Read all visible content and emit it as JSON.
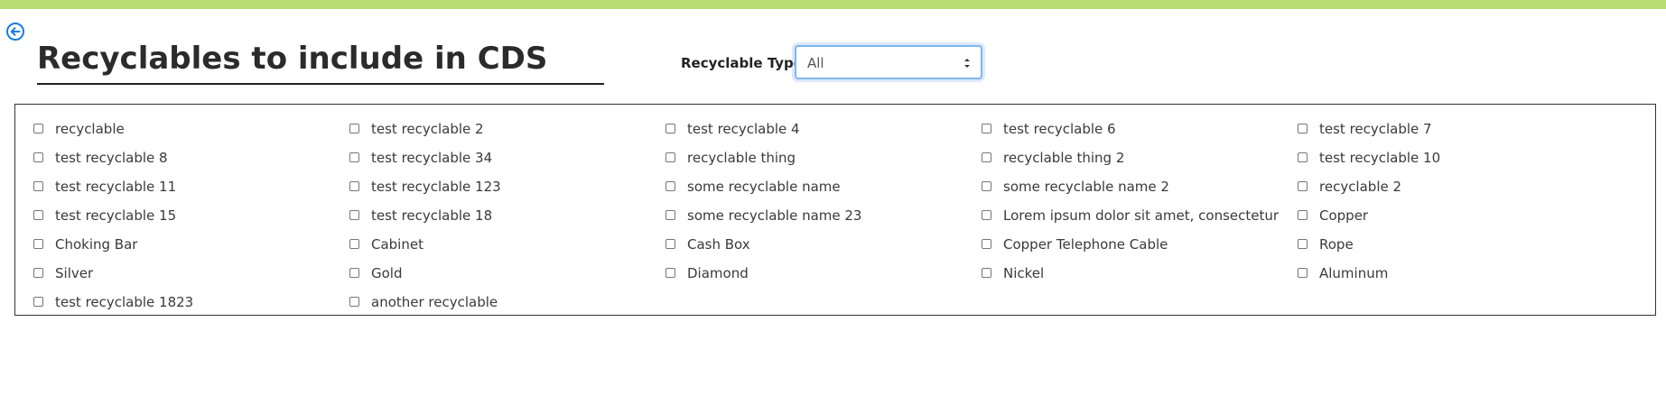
{
  "colors": {
    "top_bar": "#b9dc73",
    "back_icon": "#1a7be0"
  },
  "header": {
    "back_icon": "arrow-left-circle-icon",
    "title": "Recyclables to include in CDS"
  },
  "filter": {
    "label": "Recyclable Type:",
    "selected": "All",
    "caret_icon": "select-caret-icon"
  },
  "recyclables": [
    "recyclable",
    "test recyclable 2",
    "test recyclable 4",
    "test recyclable 6",
    "test recyclable 7",
    "test recyclable 8",
    "test recyclable 34",
    "recyclable thing",
    "recyclable thing 2",
    "test recyclable 10",
    "test recyclable 11",
    "test recyclable 123",
    "some recyclable name",
    "some recyclable name 2",
    "recyclable 2",
    "test recyclable 15",
    "test recyclable 18",
    "some recyclable name 23",
    "Lorem ipsum dolor sit amet, consectetur",
    "Copper",
    "Choking Bar",
    "Cabinet",
    "Cash Box",
    "Copper Telephone Cable",
    "Rope",
    "Silver",
    "Gold",
    "Diamond",
    "Nickel",
    "Aluminum",
    "test recyclable 1823",
    "another recyclable"
  ]
}
